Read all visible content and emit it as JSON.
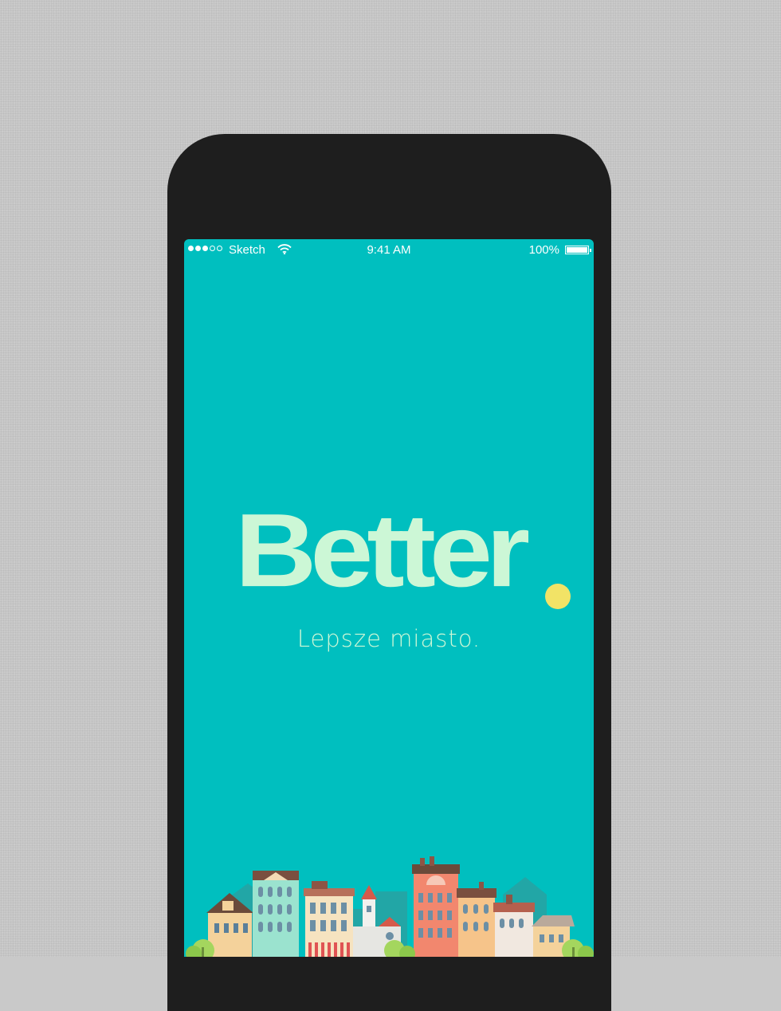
{
  "status_bar": {
    "carrier": "Sketch",
    "time": "9:41 AM",
    "battery_percent": "100%",
    "signal_bars_filled": 3,
    "signal_bars_total": 5
  },
  "splash": {
    "logo_text": "Better",
    "tagline": "Lepsze miasto."
  },
  "colors": {
    "background": "#00bfbf",
    "logo": "#ccf7d6",
    "logo_dot": "#f2e366",
    "device": "#1e1e1e"
  },
  "icons": [
    "wifi-icon",
    "battery-icon",
    "city-illustration"
  ]
}
